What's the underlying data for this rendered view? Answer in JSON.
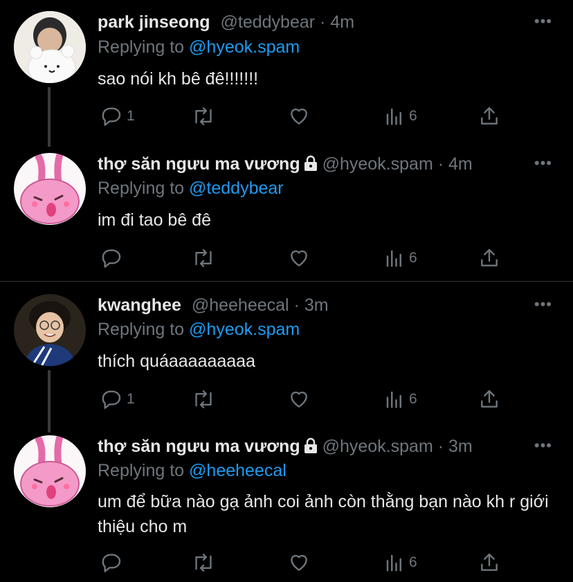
{
  "tweets": [
    {
      "name": "park jinseong",
      "handle": "@teddybear",
      "time": "4m",
      "replying_label": "Replying to",
      "replying_to": "@hyeok.spam",
      "text": "sao nói kh bê đê!!!!!!!",
      "reply_count": "1",
      "view_count": "6",
      "locked": false,
      "avatar": "teddy-bear-avatar"
    },
    {
      "name": "thợ săn ngưu ma vương",
      "handle": "@hyeok.spam",
      "time": "4m",
      "replying_label": "Replying to",
      "replying_to": "@teddybear",
      "text": "im đi tao bê đê",
      "reply_count": "",
      "view_count": "6",
      "locked": true,
      "avatar": "pink-bunny-avatar"
    },
    {
      "name": "kwanghee",
      "handle": "@heeheecal",
      "time": "3m",
      "replying_label": "Replying to",
      "replying_to": "@hyeok.spam",
      "text": "thích quáaaaaaaaaa",
      "reply_count": "1",
      "view_count": "6",
      "locked": false,
      "avatar": "person-glasses-avatar"
    },
    {
      "name": "thợ săn ngưu ma vương",
      "handle": "@hyeok.spam",
      "time": "3m",
      "replying_label": "Replying to",
      "replying_to": "@heeheecal",
      "text": "um để bữa nào gạ ảnh coi ảnh còn thằng bạn nào kh r giới thiệu cho m",
      "reply_count": "",
      "view_count": "6",
      "locked": true,
      "avatar": "pink-bunny-avatar"
    }
  ],
  "colors": {
    "background": "#000000",
    "link": "#1d9bf0",
    "muted": "#6e767d",
    "text": "#e7e7e7"
  },
  "icons": [
    "reply-icon",
    "retweet-icon",
    "like-icon",
    "views-icon",
    "share-icon",
    "more-icon",
    "lock-icon"
  ]
}
